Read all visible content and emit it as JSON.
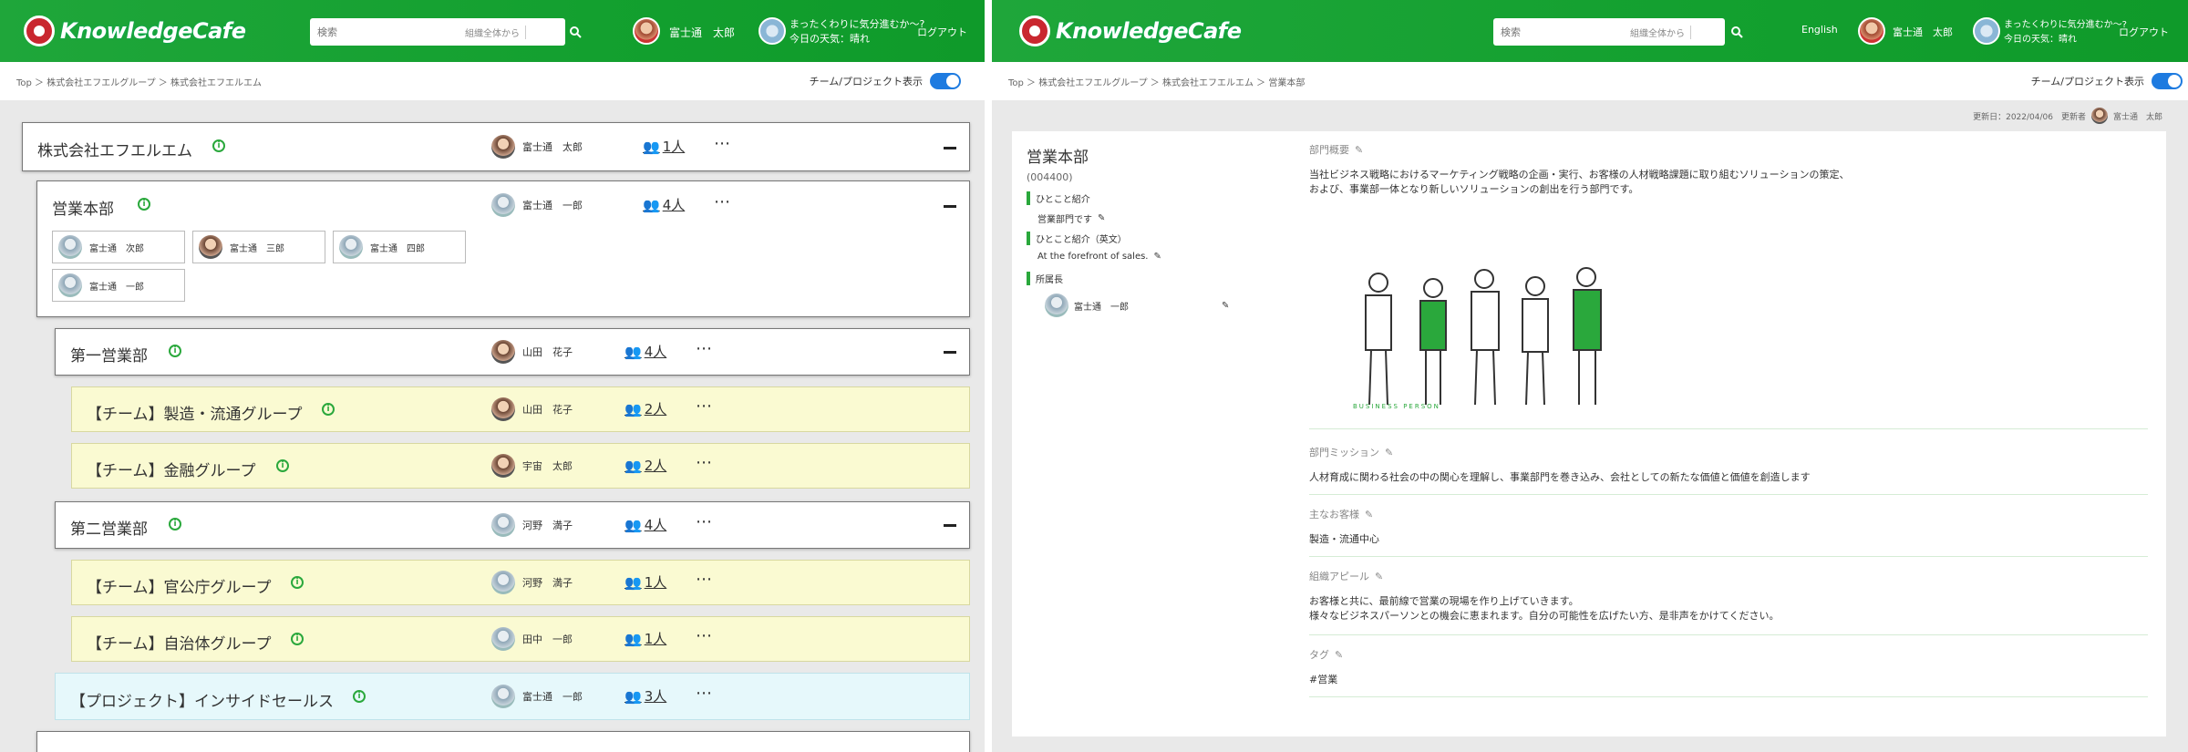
{
  "left": {
    "header": {
      "logo_text": "KnowledgeCafe",
      "search_placeholder": "検索",
      "search_scope": "組織全体から",
      "user_name": "富士通　太郎",
      "mood_line1": "まったくわりに気分進むか〜?",
      "mood_line2": "今日の天気：晴れ",
      "logout": "ログアウト"
    },
    "breadcrumb": "Top ＞ 株式会社エフエルグループ ＞ 株式会社エフエルエム",
    "toggle_label": "チーム/プロジェクト表示",
    "tree": [
      {
        "name": "株式会社エフエルエム",
        "manager": "富士通　太郎",
        "count": "1人",
        "kind": "company"
      },
      {
        "name": "営業本部",
        "manager": "富士通　一郎",
        "count": "4人",
        "kind": "division",
        "members": [
          "富士通　次郎",
          "富士通　三郎",
          "富士通　四郎",
          "富士通　一郎"
        ]
      },
      {
        "name": "第一営業部",
        "manager": "山田　花子",
        "count": "4人",
        "kind": "dept"
      },
      {
        "name": "【チーム】製造・流通グループ",
        "manager": "山田　花子",
        "count": "2人",
        "kind": "team"
      },
      {
        "name": "【チーム】金融グループ",
        "manager": "宇宙　太郎",
        "count": "2人",
        "kind": "team"
      },
      {
        "name": "第二営業部",
        "manager": "河野　満子",
        "count": "4人",
        "kind": "dept"
      },
      {
        "name": "【チーム】官公庁グループ",
        "manager": "河野　満子",
        "count": "1人",
        "kind": "team"
      },
      {
        "name": "【チーム】自治体グループ",
        "manager": "田中　一郎",
        "count": "1人",
        "kind": "team"
      },
      {
        "name": "【プロジェクト】インサイドセールス",
        "manager": "富士通　一郎",
        "count": "3人",
        "kind": "project"
      }
    ]
  },
  "right": {
    "header": {
      "logo_text": "KnowledgeCafe",
      "search_placeholder": "検索",
      "search_scope": "組織全体から",
      "language": "English",
      "user_name": "富士通　太郎",
      "mood_line1": "まったくわりに気分進むか〜?",
      "mood_line2": "今日の天気：晴れ",
      "logout": "ログアウト"
    },
    "breadcrumb": "Top ＞ 株式会社エフエルグループ ＞ 株式会社エフエルエム ＞ 営業本部",
    "toggle_label": "チーム/プロジェクト表示",
    "meta": {
      "updated": "更新日：2022/04/06　更新者",
      "updater": "富士通　太郎"
    },
    "dept": {
      "title": "営業本部",
      "code": "(004400)",
      "intro_label": "ひとこと紹介",
      "intro_value": "営業部門です",
      "intro_en_label": "ひとこと紹介（英文）",
      "intro_en_value": "At the forefront of sales.",
      "head_label": "所属長",
      "head_value": "富士通　一郎"
    },
    "sections": {
      "overview_label": "部門概要",
      "overview_line1": "当社ビジネス戦略におけるマーケティング戦略の企画・実行、お客様の人材戦略課題に取り組むソリューションの策定、",
      "overview_line2": "および、事業部一体となり新しいソリューションの創出を行う部門です。",
      "image_caption": "BUSINESS PERSON",
      "mission_label": "部門ミッション",
      "mission_text": "人材育成に関わる社会の中の関心を理解し、事業部門を巻き込み、会社としての新たな価値と価値を創造します",
      "clients_label": "主なお客様",
      "clients_text": "製造・流通中心",
      "appeal_label": "組織アピール",
      "appeal_line1": "お客様と共に、最前線で営業の現場を作り上げていきます。",
      "appeal_line2": "様々なビジネスパーソンとの機会に恵まれます。自分の可能性を広げたい方、是非声をかけてください。",
      "tags_label": "タグ",
      "tags_text": "#営業"
    }
  }
}
